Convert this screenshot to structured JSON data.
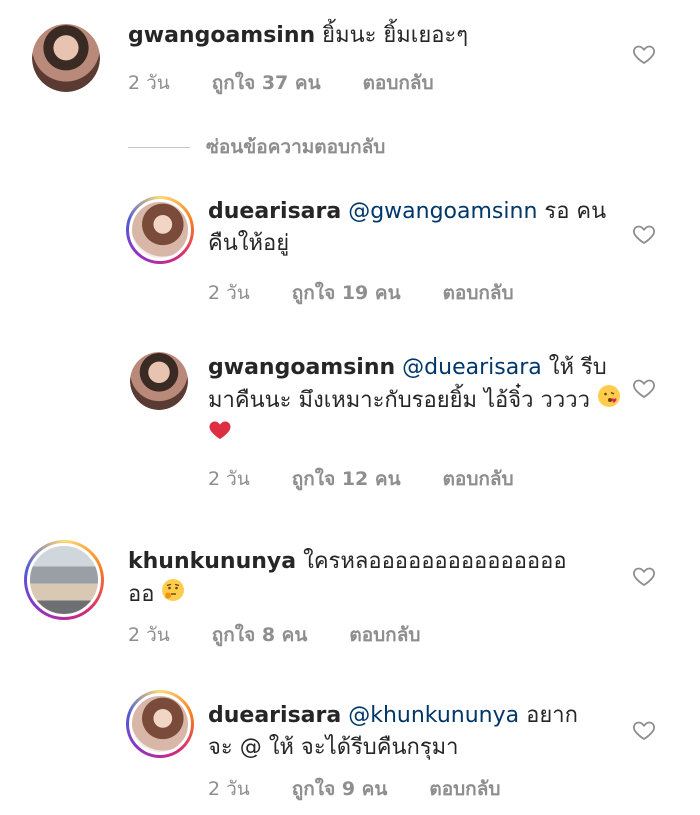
{
  "hide_replies_label": "ซ่อนข้อความตอบกลับ",
  "comments": [
    {
      "username": "gwangoamsinn",
      "mention": "",
      "text": "ยิ้มนะ ยิ้มเยอะๆ",
      "time": "2 วัน",
      "likes": "ถูกใจ 37 คน",
      "reply": "ตอบกลับ",
      "avatar": "gwangoamsinn-avatar",
      "icon": "heart-outline-icon"
    },
    {
      "username": "duearisara",
      "mention": "@gwangoamsinn",
      "text": "รอ คนคืนให้อยู่",
      "time": "2 วัน",
      "likes": "ถูกใจ 19 คน",
      "reply": "ตอบกลับ",
      "avatar": "duearisara-avatar",
      "icon": "heart-outline-icon"
    },
    {
      "username": "gwangoamsinn",
      "mention": "@duearisara",
      "text": "ให้ รีบมาคืนนะ มึงเหมาะกับรอยยิ้ม ไอ้จิ๋ว วววว",
      "time": "2 วัน",
      "likes": "ถูกใจ 12 คน",
      "reply": "ตอบกลับ",
      "avatar": "gwangoamsinn-avatar",
      "icon": "heart-outline-icon"
    },
    {
      "username": "khunkununya",
      "mention": "",
      "text": "ใครหลอออออออออออออออ ออ",
      "time": "2 วัน",
      "likes": "ถูกใจ 8 คน",
      "reply": "ตอบกลับ",
      "avatar": "khunkununya-avatar",
      "icon": "heart-outline-icon"
    },
    {
      "username": "duearisara",
      "mention": "@khunkununya",
      "text": "อยาก จะ @ ให้ จะได้รีบคืนกรุมา",
      "time": "2 วัน",
      "likes": "ถูกใจ 9 คน",
      "reply": "ตอบกลับ",
      "avatar": "duearisara-avatar",
      "icon": "heart-outline-icon"
    }
  ]
}
